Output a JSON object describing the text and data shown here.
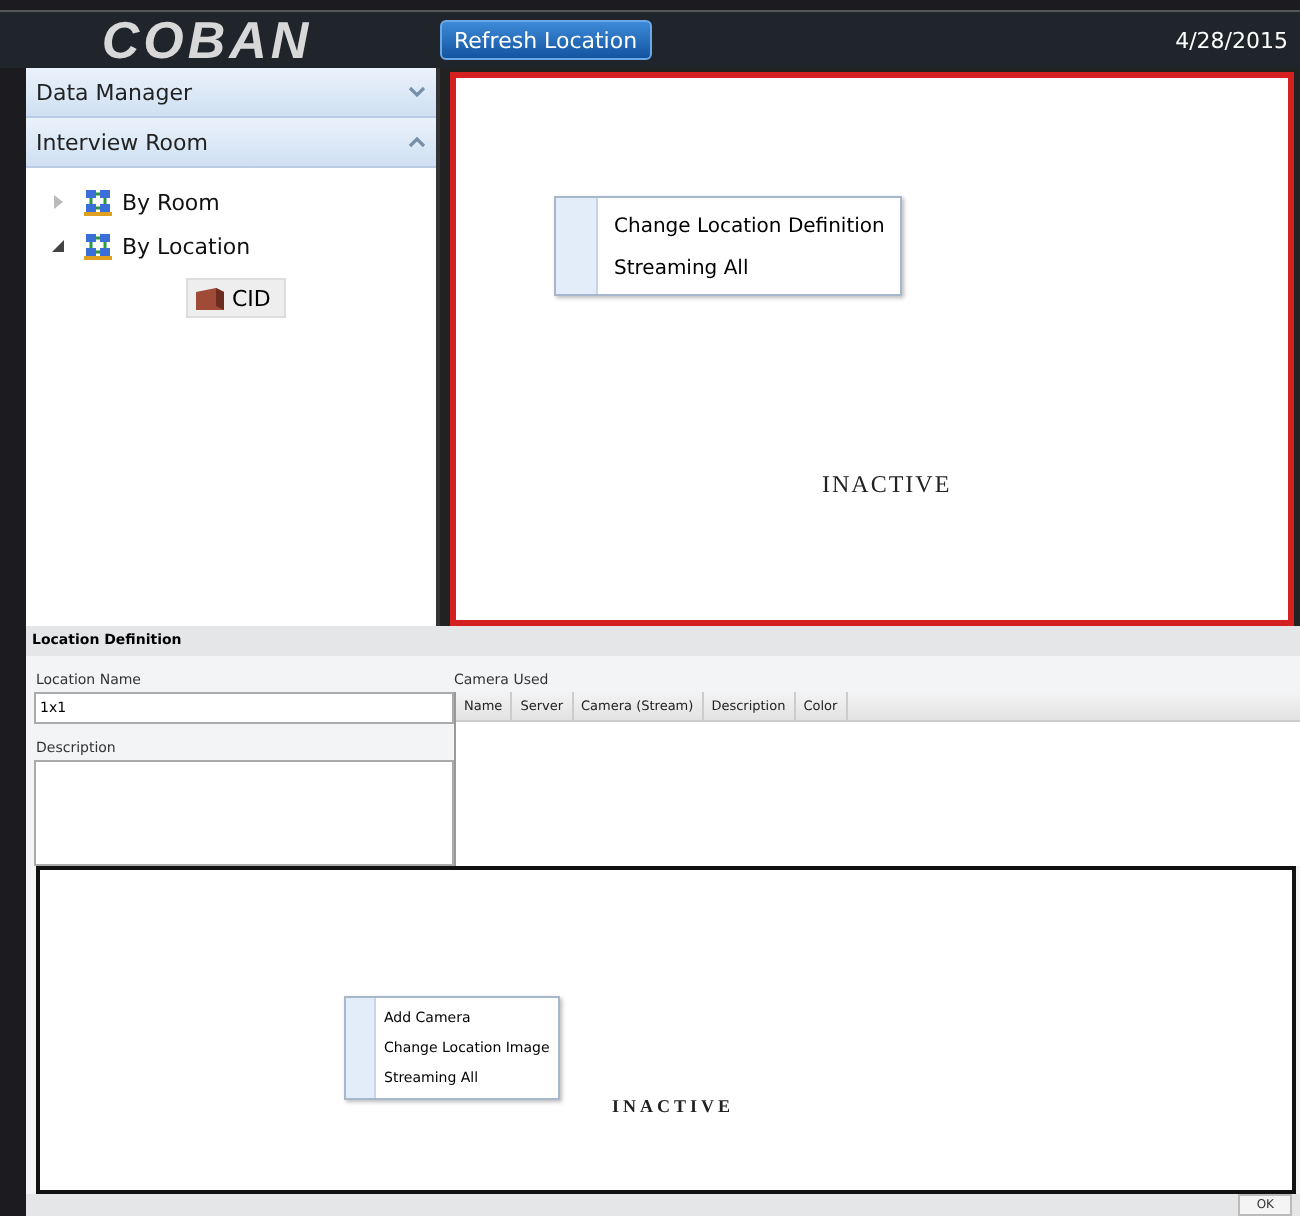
{
  "header": {
    "logo": "COBAN",
    "refresh_button": "Refresh Location",
    "date": "4/28/2015"
  },
  "sidebar": {
    "sections": [
      {
        "label": "Data Manager",
        "expanded": false
      },
      {
        "label": "Interview Room",
        "expanded": true,
        "tree": [
          {
            "label": "By Room",
            "expanded": false
          },
          {
            "label": "By Location",
            "expanded": true,
            "children": [
              {
                "label": "CID",
                "selected": true
              }
            ]
          }
        ]
      }
    ]
  },
  "viewer": {
    "status": "INACTIVE",
    "context_menu": [
      "Change Location Definition",
      "Streaming All"
    ]
  },
  "location_definition": {
    "title": "Location Definition",
    "location_name": {
      "label": "Location Name",
      "value": "1x1"
    },
    "description": {
      "label": "Description"
    },
    "camera_used": {
      "label": "Camera Used",
      "columns": [
        "Name",
        "Server",
        "Camera (Stream)",
        "Description",
        "Color"
      ]
    },
    "preview": {
      "status": "INACTIVE",
      "context_menu": [
        "Add Camera",
        "Change Location Image",
        "Streaming All"
      ]
    },
    "ok_button": "OK"
  }
}
